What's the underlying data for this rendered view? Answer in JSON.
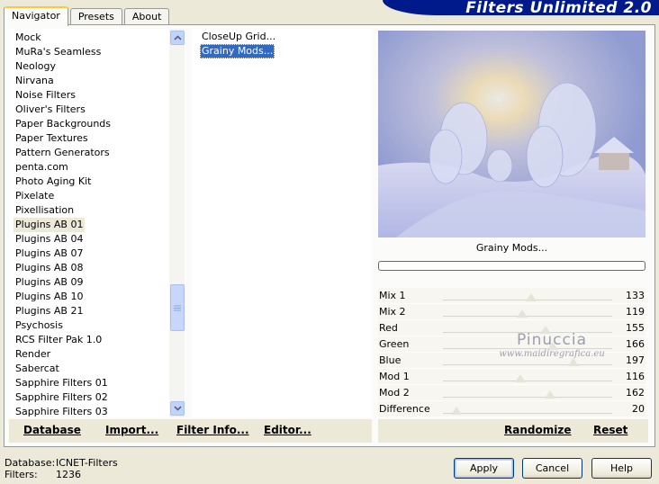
{
  "tabs": [
    "Navigator",
    "Presets",
    "About"
  ],
  "banner_title": "Filters Unlimited 2.0",
  "categories": [
    "Mock",
    "MuRa's Seamless",
    "Neology",
    "Nirvana",
    "Noise Filters",
    "Oliver's Filters",
    "Paper Backgrounds",
    "Paper Textures",
    "Pattern Generators",
    "penta.com",
    "Photo Aging Kit",
    "Pixelate",
    "Pixellisation",
    "Plugins AB 01",
    "Plugins AB 04",
    "Plugins AB 07",
    "Plugins AB 08",
    "Plugins AB 09",
    "Plugins AB 10",
    "Plugins AB 21",
    "Psychosis",
    "RCS Filter Pak 1.0",
    "Render",
    "Sabercat",
    "Sapphire Filters 01",
    "Sapphire Filters 02",
    "Sapphire Filters 03"
  ],
  "selected_category": "Plugins AB 01",
  "filters": [
    "CloseUp Grid...",
    "Grainy Mods..."
  ],
  "selected_filter": "Grainy Mods...",
  "filter_title": "Grainy Mods...",
  "params": [
    {
      "label": "Mix 1",
      "value": "133"
    },
    {
      "label": "Mix 2",
      "value": "119"
    },
    {
      "label": "Red",
      "value": "155"
    },
    {
      "label": "Green",
      "value": "166"
    },
    {
      "label": "Blue",
      "value": "197"
    },
    {
      "label": "Mod 1",
      "value": "116"
    },
    {
      "label": "Mod 2",
      "value": "162"
    },
    {
      "label": "Difference",
      "value": "20"
    }
  ],
  "watermark": {
    "line1": "Pinuccia",
    "line2": "www.maidiregrafica.eu"
  },
  "left_buttons": {
    "database": "Database",
    "import": "Import...",
    "filter_info": "Filter Info...",
    "editor": "Editor..."
  },
  "right_buttons": {
    "randomize": "Randomize",
    "reset": "Reset"
  },
  "status": {
    "database_label": "Database:",
    "database_value": "ICNET-Filters",
    "filters_label": "Filters:",
    "filters_value": "1236"
  },
  "dialog_buttons": {
    "apply": "Apply",
    "cancel": "Cancel",
    "help": "Help"
  },
  "colors": {
    "banner": "#001a8c",
    "selection": "#316ac5",
    "panel": "#ece9d8"
  }
}
